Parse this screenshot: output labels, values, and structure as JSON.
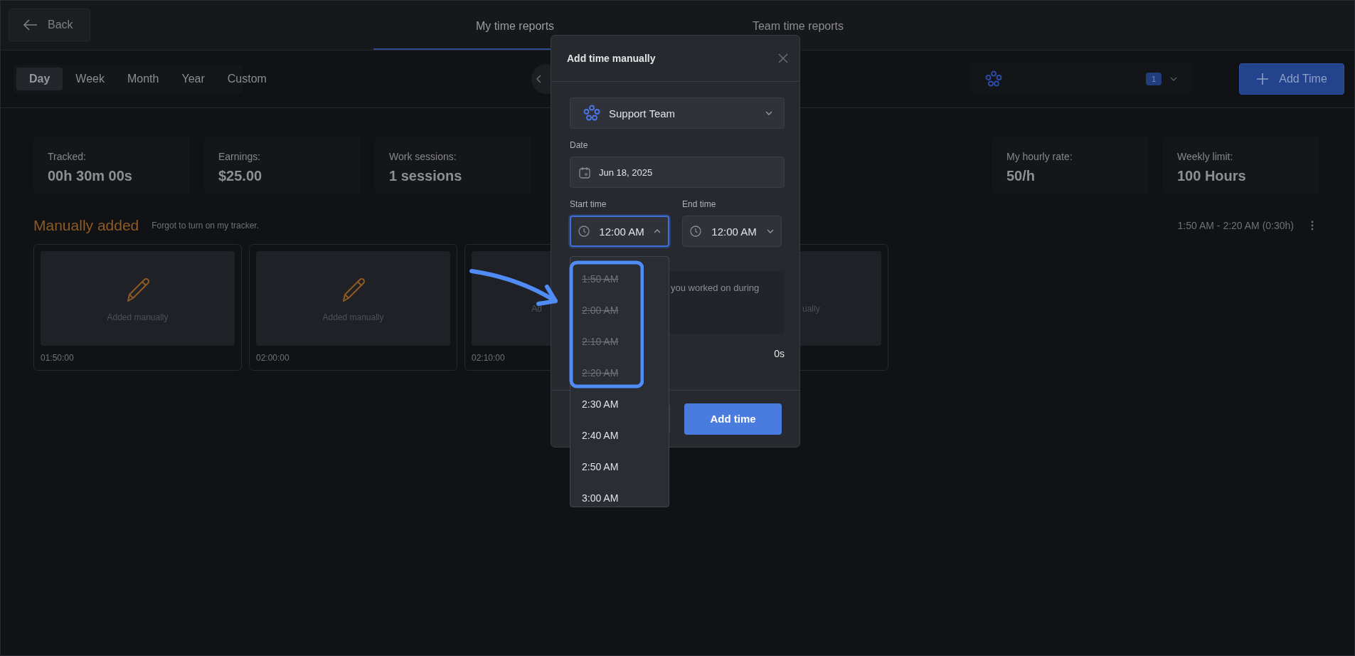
{
  "header": {
    "back": "Back",
    "tabs": [
      {
        "label": "My time reports",
        "selected": true
      },
      {
        "label": "Team time reports",
        "selected": false
      }
    ]
  },
  "toolbar": {
    "periods": [
      {
        "label": "Day",
        "selected": true
      },
      {
        "label": "Week",
        "selected": false
      },
      {
        "label": "Month",
        "selected": false
      },
      {
        "label": "Year",
        "selected": false
      },
      {
        "label": "Custom",
        "selected": false
      }
    ],
    "team_badge": "1",
    "add_button": "Add Time"
  },
  "stats_left": [
    {
      "label": "Tracked:",
      "value": "00h 30m 00s"
    },
    {
      "label": "Earnings:",
      "value": "$25.00"
    },
    {
      "label": "Work sessions:",
      "value": "1 sessions"
    }
  ],
  "stats_right": [
    {
      "label": "My hourly rate:",
      "value": "50/h"
    },
    {
      "label": "Weekly limit:",
      "value": "100 Hours"
    }
  ],
  "section": {
    "title": "Manually added",
    "note": "Forgot to turn on my tracker.",
    "range": "1:50 AM - 2:20 AM (0:30h)"
  },
  "entries": [
    {
      "kind": "full",
      "label": "Added manually",
      "time": "01:50:00"
    },
    {
      "kind": "full",
      "label": "Added manually",
      "time": "02:00:00"
    },
    {
      "kind": "clip-end",
      "label": "Ad",
      "time": "02:10:00"
    },
    {
      "kind": "clip-start",
      "label": "ually"
    }
  ],
  "modal": {
    "title": "Add time manually",
    "team": "Support Team",
    "date_label": "Date",
    "date": "Jun 18, 2025",
    "start_label": "Start time",
    "start": "12:00 AM",
    "start_expanded": true,
    "end_label": "End time",
    "end": "12:00 AM",
    "description_placeholder": "you worked on during",
    "duration": "0s",
    "submit": "Add time"
  },
  "start_options": [
    {
      "label": "1:50 AM",
      "disabled": true
    },
    {
      "label": "2:00 AM",
      "disabled": true
    },
    {
      "label": "2:10 AM",
      "disabled": true
    },
    {
      "label": "2:20 AM",
      "disabled": true
    },
    {
      "label": "2:30 AM",
      "disabled": false
    },
    {
      "label": "2:40 AM",
      "disabled": false
    },
    {
      "label": "2:50 AM",
      "disabled": false
    },
    {
      "label": "3:00 AM",
      "disabled": false
    }
  ]
}
